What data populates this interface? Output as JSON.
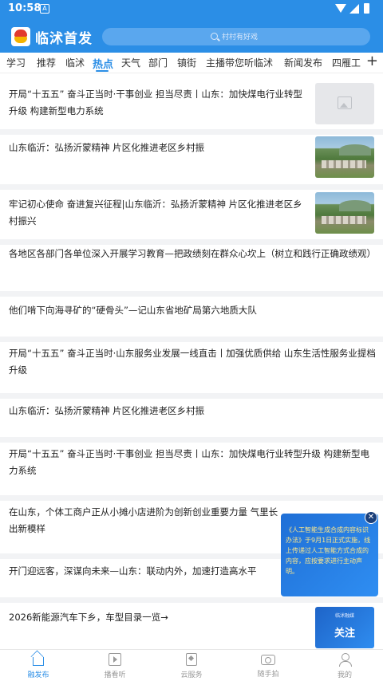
{
  "status": {
    "time": "10:58",
    "notification_badge": "A"
  },
  "header": {
    "title": "临沭首发",
    "search_placeholder": "村村有好戏"
  },
  "tabs": [
    "学习",
    "推荐",
    "临沭",
    "热点",
    "天气",
    "部门",
    "镇街",
    "主播带您听临沭",
    "新闻发布",
    "四雁工"
  ],
  "active_tab": "热点",
  "news": [
    {
      "title": "开局“十五五” 奋斗正当时·干事创业 担当尽责丨山东：加快煤电行业转型升级 构建新型电力系统",
      "thumb": "placeholder"
    },
    {
      "title": "山东临沂：弘扬沂蒙精神 片区化推进老区乡村振",
      "thumb": "landscape"
    },
    {
      "title": "牢记初心使命 奋进复兴征程|山东临沂：弘扬沂蒙精神 片区化推进老区乡村振兴",
      "thumb": "landscape"
    },
    {
      "title": "各地区各部门各单位深入开展学习教育—把政绩刻在群众心坎上（树立和践行正确政绩观）",
      "thumb": "none"
    },
    {
      "title": "他们啃下向海寻矿的“硬骨头”—记山东省地矿局第六地质大队",
      "thumb": "none"
    },
    {
      "title": "开局“十五五” 奋斗正当时·山东服务业发展一线直击丨加强优质供给 山东生活性服务业提档升级",
      "thumb": "none"
    },
    {
      "title": "山东临沂：弘扬沂蒙精神 片区化推进老区乡村振",
      "thumb": "none"
    },
    {
      "title": "开局“十五五” 奋斗正当时·干事创业 担当尽责丨山东：加快煤电行业转型升级 构建新型电力系统",
      "thumb": "none"
    },
    {
      "title": "在山东，个体工商户正从小摊小店进阶为创新创业重要力量 气里长出新模样",
      "thumb": "none"
    },
    {
      "title": "开门迎远客，深谋向未来—山东：联动内外，加速打造高水平",
      "thumb": "none"
    },
    {
      "title": "2026新能源汽车下乡，车型目录一览→",
      "thumb": "blue"
    }
  ],
  "blue_thumb": {
    "small": "临沭融媒",
    "big": "关注"
  },
  "ad": {
    "text": "《人工智能生成合成内容标识办法》于9月1日正式实施，线上传递过人工智能方式合成的内容，应按要求进行主动声明。"
  },
  "bottom_nav": [
    {
      "label": "融发布",
      "icon": "home-icon"
    },
    {
      "label": "播看听",
      "icon": "video-icon"
    },
    {
      "label": "云服务",
      "icon": "bookmark-icon"
    },
    {
      "label": "随手拍",
      "icon": "camera-icon"
    },
    {
      "label": "我的",
      "icon": "user-icon"
    }
  ],
  "colors": {
    "brand": "#2b8ee6",
    "divider": "#f2f3f5"
  }
}
